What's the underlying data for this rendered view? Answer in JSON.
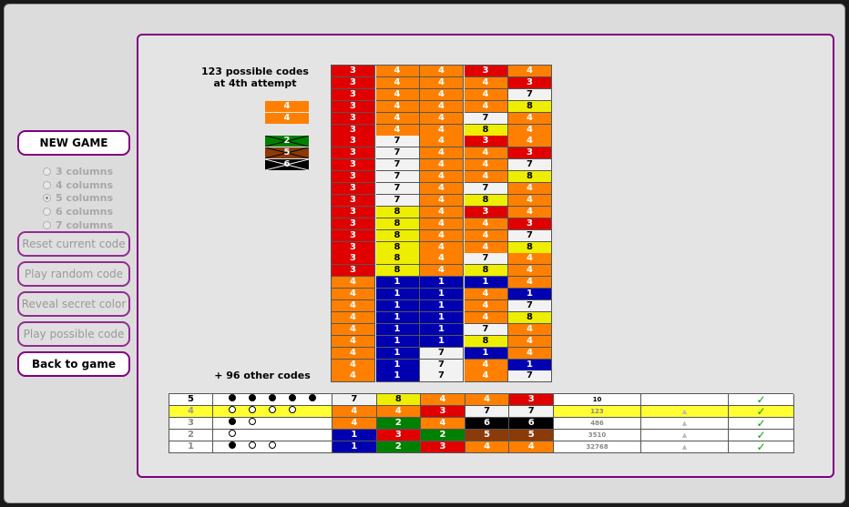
{
  "sidebar": {
    "new_game": "NEW GAME",
    "radios": [
      {
        "label": "3 columns",
        "checked": false
      },
      {
        "label": "4 columns",
        "checked": false
      },
      {
        "label": "5 columns",
        "checked": true
      },
      {
        "label": "6 columns",
        "checked": false
      },
      {
        "label": "7 columns",
        "checked": false
      }
    ],
    "reset": "Reset current code",
    "play_random": "Play random code",
    "reveal": "Reveal secret color",
    "play_possible": "Play possible code",
    "back": "Back to game"
  },
  "possible": {
    "title_line1": "123 possible codes",
    "title_line2": "at 4th attempt",
    "more": "+ 96 other codes",
    "hint_fixed": [
      {
        "value": "4",
        "color": "orange"
      },
      {
        "value": "4",
        "color": "orange"
      }
    ],
    "hint_excluded": [
      {
        "value": "2",
        "color": "green"
      },
      {
        "value": "5",
        "color": "brown"
      },
      {
        "value": "6",
        "color": "black"
      }
    ],
    "codes": [
      [
        "3r",
        "4o",
        "4o",
        "3r",
        "4o"
      ],
      [
        "3r",
        "4o",
        "4o",
        "4o",
        "3r"
      ],
      [
        "3r",
        "4o",
        "4o",
        "4o",
        "7w"
      ],
      [
        "3r",
        "4o",
        "4o",
        "4o",
        "8y"
      ],
      [
        "3r",
        "4o",
        "4o",
        "7w",
        "4o"
      ],
      [
        "3r",
        "4o",
        "4o",
        "8y",
        "4o"
      ],
      [
        "3r",
        "7w",
        "4o",
        "3r",
        "4o"
      ],
      [
        "3r",
        "7w",
        "4o",
        "4o",
        "3r"
      ],
      [
        "3r",
        "7w",
        "4o",
        "4o",
        "7w"
      ],
      [
        "3r",
        "7w",
        "4o",
        "4o",
        "8y"
      ],
      [
        "3r",
        "7w",
        "4o",
        "7w",
        "4o"
      ],
      [
        "3r",
        "7w",
        "4o",
        "8y",
        "4o"
      ],
      [
        "3r",
        "8y",
        "4o",
        "3r",
        "4o"
      ],
      [
        "3r",
        "8y",
        "4o",
        "4o",
        "3r"
      ],
      [
        "3r",
        "8y",
        "4o",
        "4o",
        "7w"
      ],
      [
        "3r",
        "8y",
        "4o",
        "4o",
        "8y"
      ],
      [
        "3r",
        "8y",
        "4o",
        "7w",
        "4o"
      ],
      [
        "3r",
        "8y",
        "4o",
        "8y",
        "4o"
      ],
      [
        "4o",
        "1b",
        "1b",
        "1b",
        "4o"
      ],
      [
        "4o",
        "1b",
        "1b",
        "4o",
        "1b"
      ],
      [
        "4o",
        "1b",
        "1b",
        "4o",
        "7w"
      ],
      [
        "4o",
        "1b",
        "1b",
        "4o",
        "8y"
      ],
      [
        "4o",
        "1b",
        "1b",
        "7w",
        "4o"
      ],
      [
        "4o",
        "1b",
        "1b",
        "8y",
        "4o"
      ],
      [
        "4o",
        "1b",
        "7w",
        "1b",
        "4o"
      ],
      [
        "4o",
        "1b",
        "7w",
        "4o",
        "1b"
      ],
      [
        "4o",
        "1b",
        "7w",
        "4o",
        "7w"
      ]
    ]
  },
  "history": [
    {
      "num": "5",
      "highlight": false,
      "pegs": [
        "b",
        "b",
        "b",
        "b",
        "b"
      ],
      "code": [
        "7w",
        "8y",
        "4o",
        "4o",
        "3r"
      ],
      "count": "10",
      "tri": "",
      "ok": "✓"
    },
    {
      "num": "4",
      "highlight": true,
      "pegs": [
        "w",
        "w",
        "w",
        "w",
        "n"
      ],
      "code": [
        "4o",
        "4o",
        "3r",
        "7w",
        "7w"
      ],
      "count": "123",
      "tri": "▲",
      "ok": "✓"
    },
    {
      "num": "3",
      "highlight": false,
      "pegs": [
        "b",
        "w",
        "n",
        "n",
        "n"
      ],
      "code": [
        "4o",
        "2g",
        "4o",
        "6k",
        "6k"
      ],
      "count": "486",
      "tri": "▲",
      "ok": "✓"
    },
    {
      "num": "2",
      "highlight": false,
      "pegs": [
        "w",
        "n",
        "n",
        "n",
        "n"
      ],
      "code": [
        "1b",
        "3r",
        "2g",
        "5n",
        "5n"
      ],
      "count": "3510",
      "tri": "▲",
      "ok": "✓"
    },
    {
      "num": "1",
      "highlight": false,
      "pegs": [
        "b",
        "w",
        "w",
        "n",
        "n"
      ],
      "code": [
        "1b",
        "2g",
        "3r",
        "4o",
        "4o"
      ],
      "count": "32768",
      "tri": "▲",
      "ok": "✓"
    }
  ],
  "colors": {
    "r": "#e00000",
    "o": "#ff8000",
    "w": "#f2f2f2",
    "y": "#eeee00",
    "b": "#0000b0",
    "g": "#008000",
    "k": "#000000",
    "n": "#8b3a0a",
    "accent": "#800080",
    "highlight": "#ffff33"
  }
}
